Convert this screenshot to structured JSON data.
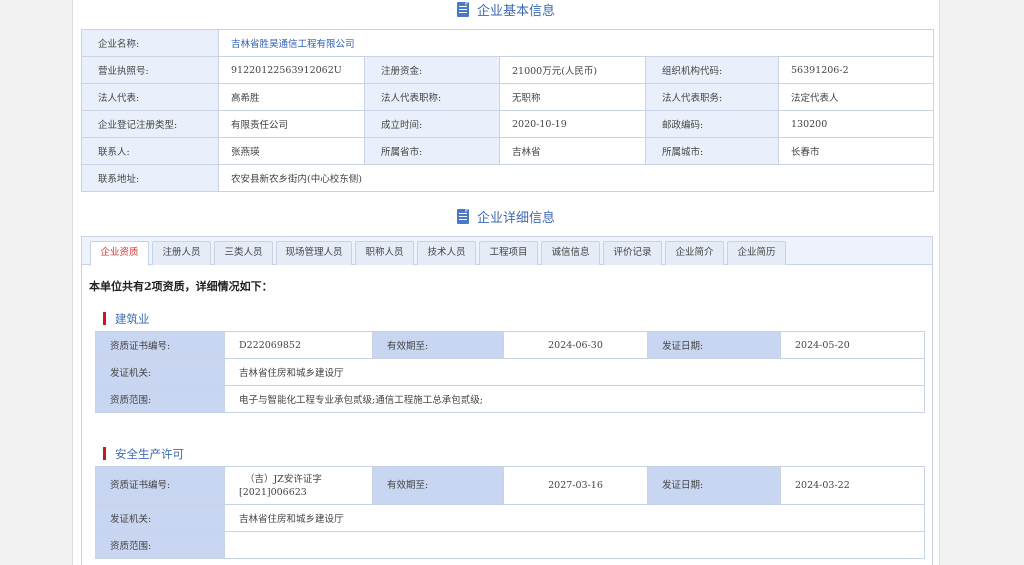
{
  "basic": {
    "title": "企业基本信息",
    "company_name_label": "企业名称:",
    "company_name": "吉林省胜昊通信工程有限公司",
    "license_label": "营业执照号:",
    "license": "91220122563912062U",
    "capital_label": "注册资金:",
    "capital": "21000万元(人民币)",
    "org_code_label": "组织机构代码:",
    "org_code": "56391206-2",
    "legal_rep_label": "法人代表:",
    "legal_rep": "高希胜",
    "legal_title_label": "法人代表职称:",
    "legal_title": "无职称",
    "legal_duty_label": "法人代表职务:",
    "legal_duty": "法定代表人",
    "reg_type_label": "企业登记注册类型:",
    "reg_type": "有限责任公司",
    "founded_label": "成立时间:",
    "founded": "2020-10-19",
    "postcode_label": "邮政编码:",
    "postcode": "130200",
    "contact_label": "联系人:",
    "contact": "张燕瑛",
    "province_label": "所属省市:",
    "province": "吉林省",
    "city_label": "所属城市:",
    "city": "长春市",
    "address_label": "联系地址:",
    "address": "农安县新农乡街内(中心校东侧)"
  },
  "detail": {
    "title": "企业详细信息",
    "tabs": [
      "企业资质",
      "注册人员",
      "三类人员",
      "现场管理人员",
      "职称人员",
      "技术人员",
      "工程项目",
      "诚信信息",
      "评价记录",
      "企业简介",
      "企业简历"
    ],
    "summary": "本单位共有2项资质，详细情况如下："
  },
  "qualifications": [
    {
      "category": "建筑业",
      "cert_no_label": "资质证书编号:",
      "cert_no": "D222069852",
      "valid_label": "有效期至:",
      "valid": "2024-06-30",
      "issue_date_label": "发证日期:",
      "issue_date": "2024-05-20",
      "issuer_label": "发证机关:",
      "issuer": "吉林省住房和城乡建设厅",
      "scope_label": "资质范围:",
      "scope": "电子与智能化工程专业承包贰级;通信工程施工总承包贰级;"
    },
    {
      "category": "安全生产许可",
      "cert_no_label": "资质证书编号:",
      "cert_no_line1": "（吉）JZ安许证字",
      "cert_no_line2": "[2021]006623",
      "valid_label": "有效期至:",
      "valid": "2027-03-16",
      "issue_date_label": "发证日期:",
      "issue_date": "2024-03-22",
      "issuer_label": "发证机关:",
      "issuer": "吉林省住房和城乡建设厅",
      "scope_label": "资质范围:",
      "scope": ""
    }
  ]
}
